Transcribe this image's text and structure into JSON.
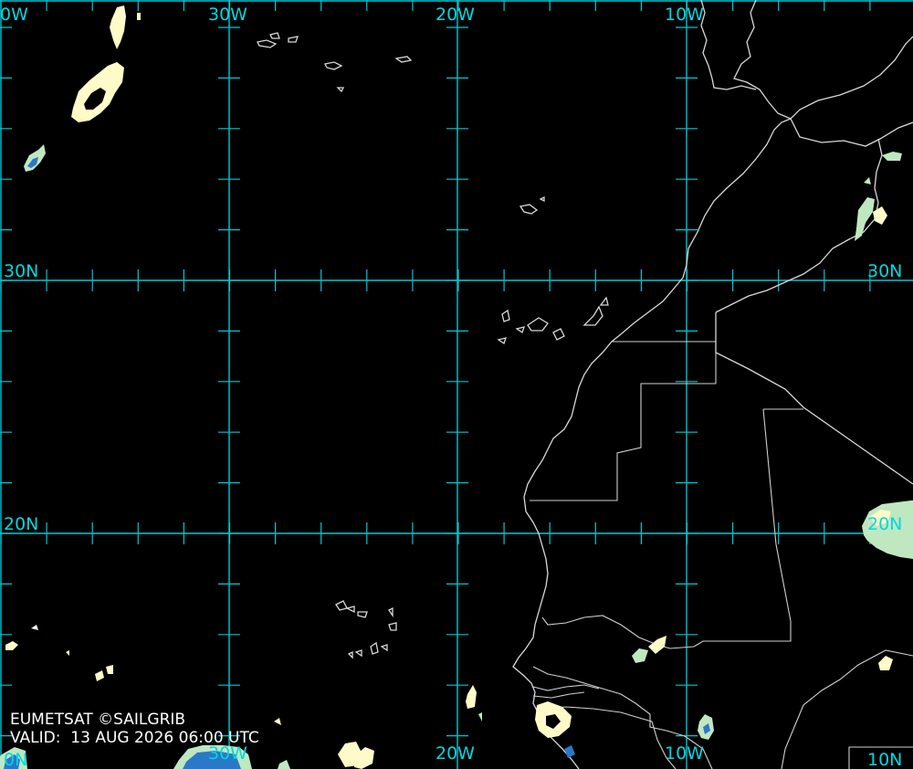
{
  "image": {
    "source_label": "EUMETSAT ©SAILGRIB",
    "valid_prefix": "VALID:",
    "valid_time": "13 AUG 2026 06:00 UTC"
  },
  "grid_labels": {
    "lon_top": [
      "0W",
      "30W",
      "20W",
      "10W"
    ],
    "lon_bottom": [
      "0N",
      "30W",
      "20W",
      "10W",
      "10N"
    ],
    "lat_left": [
      "30N",
      "20N"
    ],
    "lat_right": [
      "30N",
      "20N"
    ]
  },
  "colors": {
    "background": "#000000",
    "graticule": "#00c8d2",
    "label": "#00d8e0",
    "coastline": "#d8d8d8",
    "cloud_light": "#fffbc8",
    "cloud_mid": "#bfe8c0",
    "cloud_deep": "#2a78c8"
  }
}
